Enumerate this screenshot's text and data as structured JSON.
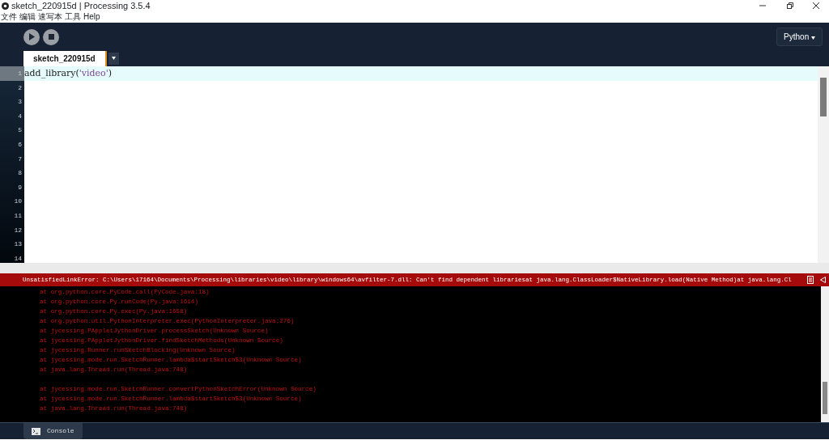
{
  "window": {
    "title": "sketch_220915d | Processing 3.5.4"
  },
  "menu": [
    "文件",
    "编辑",
    "速写本",
    "工具",
    "Help"
  ],
  "mode": {
    "label": "Python"
  },
  "tabs": [
    {
      "label": "sketch_220915d",
      "selected": true
    }
  ],
  "editor": {
    "lines": [
      {
        "number": "1",
        "current": true,
        "tokens": [
          {
            "kind": "plain",
            "text": "add_library("
          },
          {
            "kind": "string",
            "text": "'video'"
          },
          {
            "kind": "plain",
            "text": ")"
          }
        ]
      },
      {
        "number": "2",
        "current": false
      },
      {
        "number": "3",
        "current": false
      },
      {
        "number": "4",
        "current": false
      },
      {
        "number": "5",
        "current": false
      },
      {
        "number": "6",
        "current": false
      },
      {
        "number": "7",
        "current": false
      },
      {
        "number": "8",
        "current": false
      },
      {
        "number": "9",
        "current": false
      },
      {
        "number": "10",
        "current": false
      },
      {
        "number": "11",
        "current": false
      },
      {
        "number": "12",
        "current": false
      },
      {
        "number": "13",
        "current": false
      },
      {
        "number": "14",
        "current": false
      }
    ]
  },
  "error_bar": {
    "message": "UnsatisfiedLinkError: C:\\Users\\17164\\Documents\\Processing\\libraries\\video\\library\\windows64\\avfilter-7.dll: Can't find dependent librariesat java.lang.ClassLoader$NativeLibrary.load(Native Method)at java.lang.Cl"
  },
  "console": {
    "groups": [
      [
        "at org.python.core.PyCode.call(PyCode.java:18)",
        "at org.python.core.Py.runCode(Py.java:1614)",
        "at org.python.core.Py.exec(Py.java:1658)",
        "at org.python.util.PythonInterpreter.exec(PythonInterpreter.java:276)",
        "at jycessing.PAppletJythonDriver.processSketch(Unknown Source)",
        "at jycessing.PAppletJythonDriver.findSketchMethods(Unknown Source)",
        "at jycessing.Runner.runSketchBlocking(Unknown Source)",
        "at jycessing.mode.run.SketchRunner.lambda$startSketch$3(Unknown Source)",
        "at java.lang.Thread.run(Thread.java:748)"
      ],
      [
        "at jycessing.mode.run.SketchRunner.convertPythonSketchError(Unknown Source)",
        "at jycessing.mode.run.SketchRunner.lambda$startSketch$3(Unknown Source)",
        "at java.lang.Thread.run(Thread.java:748)"
      ]
    ]
  },
  "footer_tabs": [
    {
      "label": "Console",
      "selected": true
    }
  ]
}
